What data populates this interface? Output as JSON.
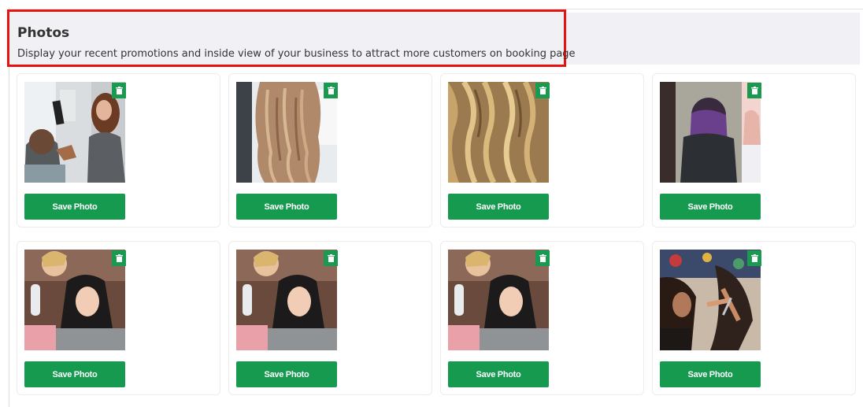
{
  "section": {
    "title": "Photos",
    "description": "Display your recent promotions and inside view of your business to attract more customers on booking page"
  },
  "photos": [
    {
      "id": 1,
      "button_label": "Save Photo",
      "subject": "stylist blow drying a client's short hair"
    },
    {
      "id": 2,
      "button_label": "Save Photo",
      "subject": "long wavy light brown hair from behind"
    },
    {
      "id": 3,
      "button_label": "Save Photo",
      "subject": "blonde curly hair close up"
    },
    {
      "id": 4,
      "button_label": "Save Photo",
      "subject": "collage with purple dyed hair and makeup"
    },
    {
      "id": 5,
      "button_label": "Save Photo",
      "subject": "stylist spraying a smiling client's dark curly hair"
    },
    {
      "id": 6,
      "button_label": "Save Photo",
      "subject": "stylist spraying a smiling client's dark curly hair"
    },
    {
      "id": 7,
      "button_label": "Save Photo",
      "subject": "stylist spraying a smiling client's dark curly hair"
    },
    {
      "id": 8,
      "button_label": "Save Photo",
      "subject": "stylist cutting hair in a salon"
    }
  ],
  "colors": {
    "accent": "#169a4f",
    "highlight_border": "#e8130f",
    "header_bg": "#f0f0f5"
  },
  "icons": {
    "delete": "trash-icon"
  }
}
